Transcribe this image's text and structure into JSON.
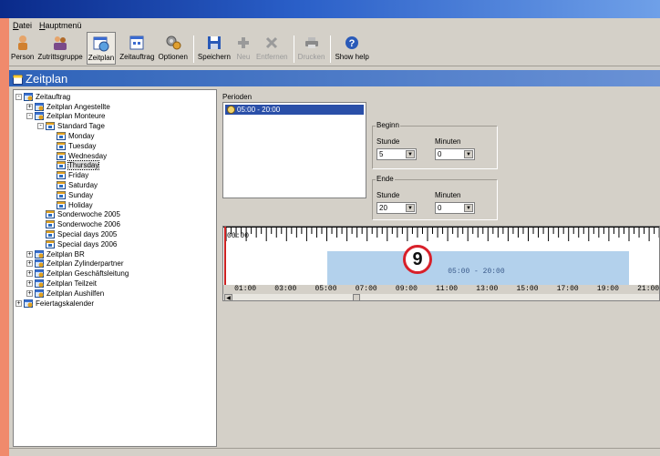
{
  "menu": [
    "Datei",
    "Hauptmenü"
  ],
  "toolbar": [
    {
      "label": "Person",
      "icon": "person-icon",
      "disabled": false
    },
    {
      "label": "Zutrittsgruppe",
      "icon": "group-icon",
      "disabled": false
    },
    {
      "label": "Zeitplan",
      "icon": "schedule-icon",
      "disabled": false,
      "active": true
    },
    {
      "label": "Zeitauftrag",
      "icon": "calendar-icon",
      "disabled": false
    },
    {
      "label": "Optionen",
      "icon": "gear-icon",
      "disabled": false
    },
    {
      "label": "Speichern",
      "icon": "save-icon",
      "disabled": false
    },
    {
      "label": "Neu",
      "icon": "plus-icon",
      "disabled": true
    },
    {
      "label": "Entfernen",
      "icon": "delete-icon",
      "disabled": true
    },
    {
      "label": "Drucken",
      "icon": "print-icon",
      "disabled": true
    },
    {
      "label": "Show help",
      "icon": "help-icon",
      "disabled": false
    }
  ],
  "section_title": "Zeitplan",
  "tree": [
    {
      "label": "Zeitauftrag",
      "level": 0,
      "exp": "-"
    },
    {
      "label": "Zeitplan Angestellte",
      "level": 1,
      "exp": "+"
    },
    {
      "label": "Zeitplan Monteure",
      "level": 1,
      "exp": "-"
    },
    {
      "label": "Standard Tage",
      "level": 2,
      "exp": "-"
    },
    {
      "label": "Monday",
      "level": 3,
      "exp": ""
    },
    {
      "label": "Tuesday",
      "level": 3,
      "exp": ""
    },
    {
      "label": "Wednesday",
      "level": 3,
      "exp": ""
    },
    {
      "label": "Thursday",
      "level": 3,
      "exp": "",
      "selected": true
    },
    {
      "label": "Friday",
      "level": 3,
      "exp": ""
    },
    {
      "label": "Saturday",
      "level": 3,
      "exp": ""
    },
    {
      "label": "Sunday",
      "level": 3,
      "exp": ""
    },
    {
      "label": "Holiday",
      "level": 3,
      "exp": ""
    },
    {
      "label": "Sonderwoche 2005",
      "level": 2,
      "exp": ""
    },
    {
      "label": "Sonderwoche 2006",
      "level": 2,
      "exp": ""
    },
    {
      "label": "Special days 2005",
      "level": 2,
      "exp": ""
    },
    {
      "label": "Special days 2006",
      "level": 2,
      "exp": ""
    },
    {
      "label": "Zeitplan BR",
      "level": 1,
      "exp": "+"
    },
    {
      "label": "Zeitplan Zylinderpartner",
      "level": 1,
      "exp": "+"
    },
    {
      "label": "Zeitplan Geschäftsleitung",
      "level": 1,
      "exp": "+"
    },
    {
      "label": "Zeitplan Teilzeit",
      "level": 1,
      "exp": "+"
    },
    {
      "label": "Zeitplan Aushilfen",
      "level": 1,
      "exp": "+"
    },
    {
      "label": "Feiertagskalender",
      "level": 0,
      "exp": "+"
    }
  ],
  "periods": {
    "label": "Perioden",
    "items": [
      "05:00 - 20:00"
    ]
  },
  "begin": {
    "title": "Beginn",
    "hour_label": "Stunde",
    "minute_label": "Minuten",
    "hour": "5",
    "minute": "0"
  },
  "end": {
    "title": "Ende",
    "hour_label": "Stunde",
    "minute_label": "Minuten",
    "hour": "20",
    "minute": "0"
  },
  "timeline": {
    "start_label": "00:00",
    "range_label": "05:00 - 20:00",
    "range_start_hour": 5,
    "range_end_hour": 20,
    "hours": [
      "01:00",
      "03:00",
      "05:00",
      "07:00",
      "09:00",
      "11:00",
      "13:00",
      "15:00",
      "17:00",
      "19:00",
      "21:00"
    ]
  },
  "callout": "9",
  "colors": {
    "header": "#2e62b8",
    "range": "#b3d1ec",
    "selection": "#2a4fa8",
    "callout_ring": "#d8202a"
  }
}
